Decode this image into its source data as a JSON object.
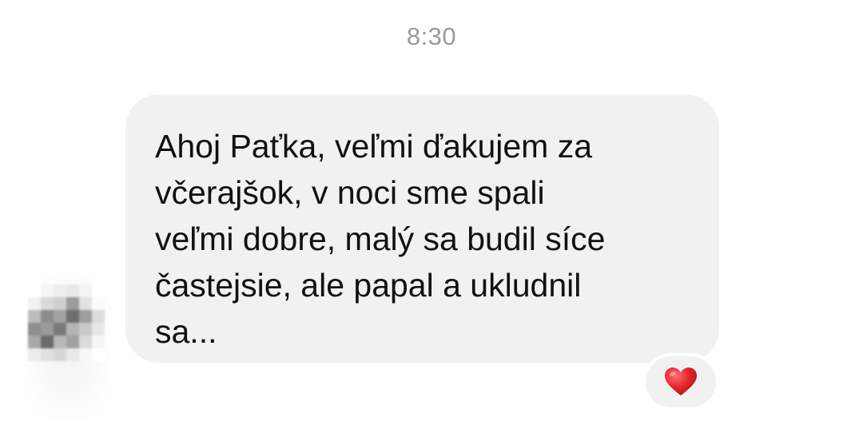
{
  "chat": {
    "timestamp": "8:30",
    "message": {
      "lines": [
        "Ahoj Paťka, veľmi ďakujem za",
        "včerajšok, v noci sme spali",
        "veľmi dobre, malý sa budil síce",
        "častejsie, ale papal a ukludnil",
        "sa..."
      ],
      "reaction": {
        "icon": "heart-icon",
        "color": "#e5262e"
      }
    },
    "sender_avatar": {
      "icon": "avatar-pixelated",
      "blurred": true
    }
  },
  "colors": {
    "bubble_bg": "#f1f1f1",
    "text": "#111111",
    "timestamp": "#9a9a9a"
  }
}
